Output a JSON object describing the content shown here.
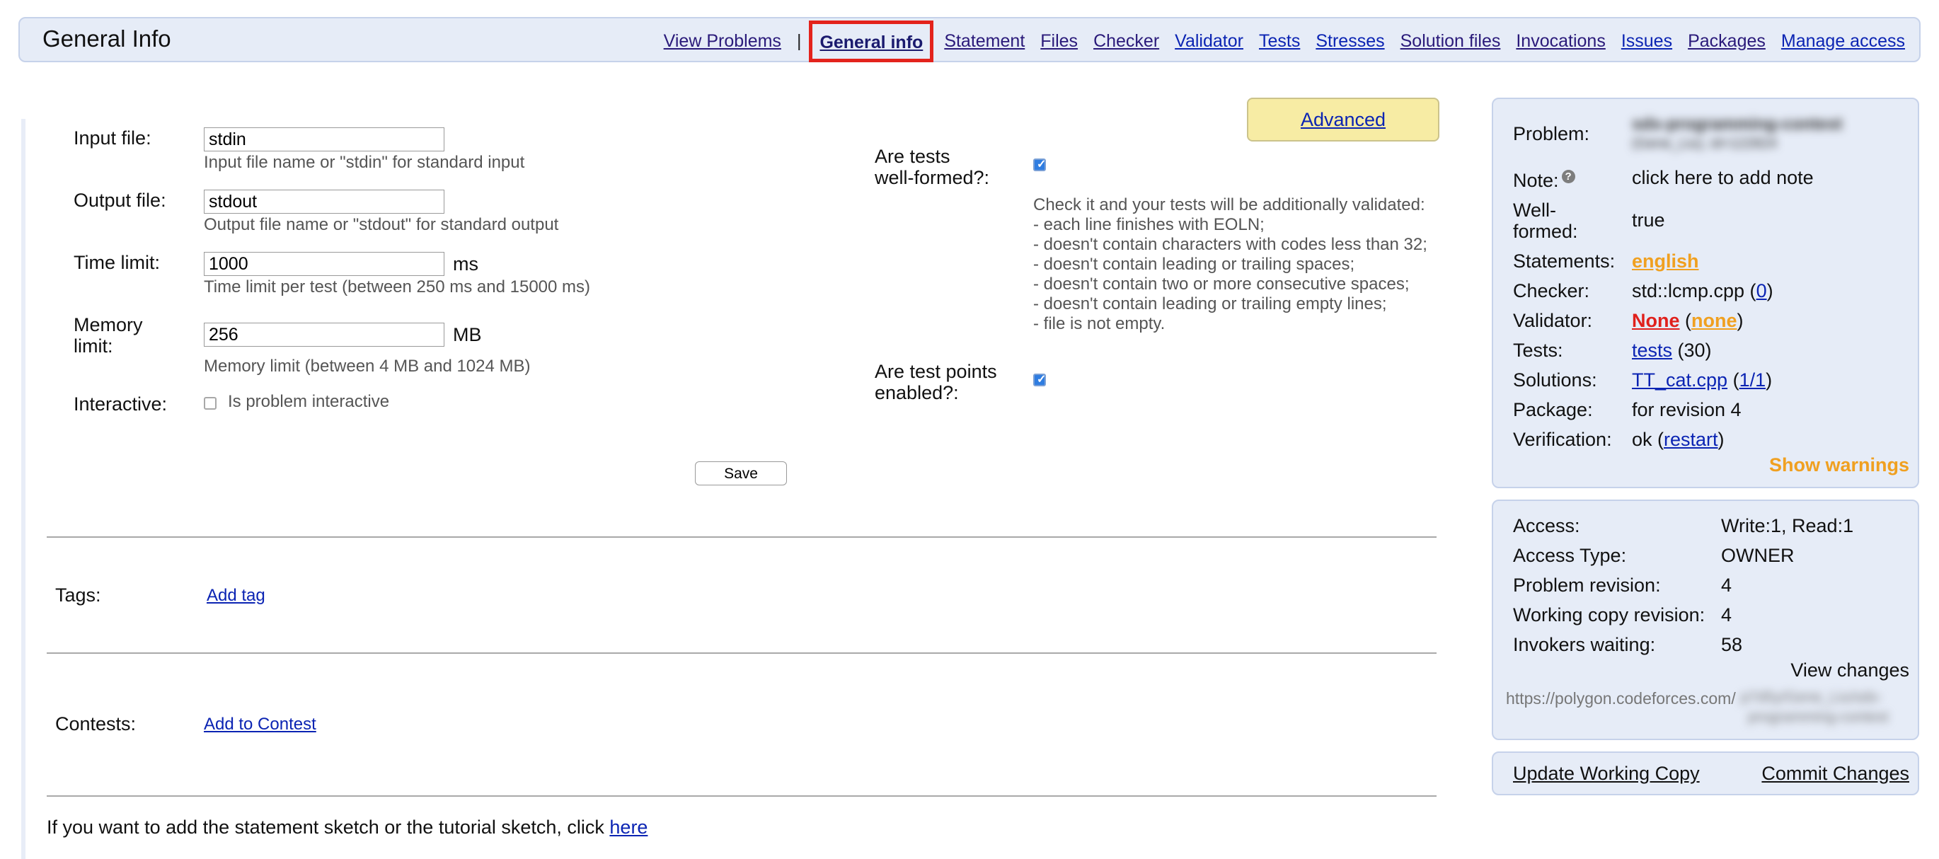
{
  "header": {
    "title": "General Info",
    "nav": [
      {
        "label": "View Problems"
      },
      {
        "label": "General info",
        "active": true
      },
      {
        "label": "Statement"
      },
      {
        "label": "Files"
      },
      {
        "label": "Checker"
      },
      {
        "label": "Validator"
      },
      {
        "label": "Tests"
      },
      {
        "label": "Stresses"
      },
      {
        "label": "Solution files"
      },
      {
        "label": "Invocations"
      },
      {
        "label": "Issues"
      },
      {
        "label": "Packages"
      },
      {
        "label": "Manage access"
      }
    ],
    "separator": "|"
  },
  "form": {
    "input_file": {
      "label": "Input file:",
      "value": "stdin",
      "hint": "Input file name or \"stdin\" for standard input"
    },
    "output_file": {
      "label": "Output file:",
      "value": "stdout",
      "hint": "Output file name or \"stdout\" for standard output"
    },
    "time_limit": {
      "label": "Time limit:",
      "value": "1000",
      "unit": "ms",
      "hint": "Time limit per test (between 250 ms and 15000 ms)"
    },
    "memory_limit": {
      "label_line1": "Memory",
      "label_line2": "limit:",
      "value": "256",
      "unit": "MB",
      "hint": "Memory limit (between 4 MB and 1024 MB)"
    },
    "interactive": {
      "label": "Interactive:",
      "checkbox_label": "Is problem interactive",
      "checked": false
    },
    "advanced_label": "Advanced",
    "tests_well_formed": {
      "label_line1": "Are tests",
      "label_line2": "well-formed?:",
      "checked": true,
      "description": [
        "Check it and your tests will be additionally validated:",
        "- each line finishes with EOLN;",
        "- doesn't contain characters with codes less than 32;",
        "- doesn't contain leading or trailing spaces;",
        "- doesn't contain two or more consecutive spaces;",
        "- doesn't contain leading or trailing empty lines;",
        "- file is not empty."
      ]
    },
    "test_points": {
      "label_line1": "Are test points",
      "label_line2": "enabled?:",
      "checked": true
    },
    "save_label": "Save"
  },
  "tags": {
    "label": "Tags:",
    "link": "Add tag"
  },
  "contests": {
    "label": "Contests:",
    "link": "Add to Contest"
  },
  "footer": {
    "text": "If you want to add the statement sketch or the tutorial sketch, click ",
    "link": "here"
  },
  "info_panel": {
    "problem_label": "Problem:",
    "problem_value_line1": "sds-programming-contest",
    "problem_value_line2": "(Gene_Liu), id=122824",
    "note_label": "Note:",
    "note_help": "?",
    "note_link": "click here to add note",
    "wellformed_label_line1": "Well-",
    "wellformed_label_line2": "formed:",
    "wellformed_value": "true",
    "statements_label": "Statements:",
    "statements_value": "english",
    "checker_label": "Checker:",
    "checker_value": "std::lcmp.cpp (",
    "checker_count": "0",
    "checker_close": ")",
    "validator_label": "Validator:",
    "validator_value": "None",
    "validator_open": " (",
    "validator_extra": "none",
    "validator_close": ")",
    "tests_label": "Tests:",
    "tests_link": "tests",
    "tests_count": " (30)",
    "solutions_label": "Solutions:",
    "solutions_link": "TT_cat.cpp",
    "solutions_open": " (",
    "solutions_ratio": "1/1",
    "solutions_close": ")",
    "package_label": "Package:",
    "package_value": "for revision 4",
    "verification_label": "Verification:",
    "verification_value": "ok (",
    "verification_link": "restart",
    "verification_close": ")",
    "show_warnings": "Show warnings"
  },
  "access_panel": {
    "access_label": "Access:",
    "access_value": "Write:1, Read:1",
    "access_type_label": "Access Type:",
    "access_type_value": "OWNER",
    "problem_revision_label": "Problem revision:",
    "problem_revision_value": "4",
    "working_copy_label": "Working copy revision:",
    "working_copy_value": "4",
    "invokers_label": "Invokers waiting:",
    "invokers_value": "58",
    "view_changes": "View changes",
    "url_prefix": "https://polygon.codeforces.com/",
    "url_hidden_line1": "p7d5y/Gene_Liu/sds-",
    "url_hidden_line2": "programming-contest"
  },
  "actions_panel": {
    "update_working_copy": "Update Working Copy",
    "commit_changes": "Commit Changes"
  },
  "colors": {
    "panel_bg": "#e6ecf7",
    "link": "#0b24b3",
    "orange": "#f0a020",
    "red": "#e0201c",
    "highlight_box": "#e3231c",
    "advanced_bg": "#f7eca4"
  }
}
